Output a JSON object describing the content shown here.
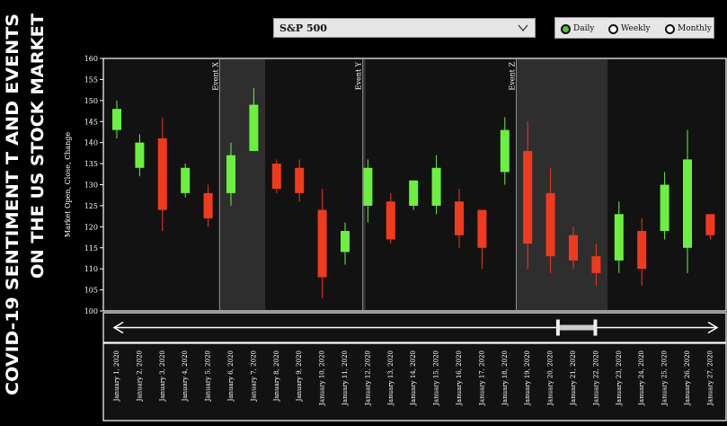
{
  "page_title": "COVID-19 SENTIMENT T AND EVENTS ON THE US STOCK MARKET",
  "page_title_lines": [
    "COVID-19 SENTIMENT T AND EVENTS",
    "ON THE US STOCK MARKET"
  ],
  "index_select": {
    "value": "S&P 500"
  },
  "period_options": [
    {
      "label": "Daily",
      "selected": true
    },
    {
      "label": "Weekly",
      "selected": false
    },
    {
      "label": "Monthly",
      "selected": false
    }
  ],
  "colors": {
    "up": "#6cf040",
    "down": "#f03a1e",
    "event_shade": "#2e2e2e",
    "panel": "#121212",
    "accent": "#5fbf3a"
  },
  "chart_data": {
    "type": "candlestick",
    "ylabel": "Market Open, Close, Change",
    "ylim": [
      100,
      160
    ],
    "yticks": [
      100,
      105,
      110,
      115,
      120,
      125,
      130,
      135,
      140,
      145,
      150,
      155,
      160
    ],
    "categories": [
      "January 1, 2020",
      "January 2, 2020",
      "January 3, 2020",
      "January 4, 2020",
      "January 5, 2020",
      "January 6, 2020",
      "January 7, 2020",
      "January 8, 2020",
      "January 9, 2020",
      "January 10, 2020",
      "January 11, 2020",
      "January 12, 2020",
      "January 13, 2020",
      "January 14, 2020",
      "January 15, 2020",
      "January 16, 2020",
      "January 17, 2020",
      "January 18, 2020",
      "January 19, 2020",
      "January 20, 2020",
      "January 21, 2020",
      "January 22, 2020",
      "January 23, 2020",
      "January 24, 2020",
      "January 25, 2020",
      "January 26, 2020",
      "January 27, 2020"
    ],
    "open": [
      143,
      134,
      141,
      128,
      128,
      128,
      138,
      135,
      134,
      124,
      114,
      125,
      126,
      125,
      125,
      126,
      124,
      133,
      138,
      128,
      118,
      113,
      112,
      119,
      119,
      115,
      123
    ],
    "close": [
      148,
      140,
      124,
      134,
      122,
      137,
      149,
      129,
      128,
      108,
      119,
      134,
      117,
      131,
      134,
      118,
      115,
      143,
      116,
      113,
      112,
      109,
      123,
      110,
      130,
      136,
      118
    ],
    "high": [
      150,
      142,
      146,
      135,
      130,
      140,
      153,
      136,
      136,
      129,
      121,
      136,
      128,
      131,
      137,
      129,
      124,
      146,
      145,
      134,
      120,
      116,
      126,
      122,
      133,
      143,
      123
    ],
    "low": [
      141,
      132,
      119,
      127,
      120,
      125,
      138,
      128,
      126,
      103,
      111,
      121,
      116,
      124,
      123,
      115,
      110,
      130,
      110,
      109,
      110,
      106,
      109,
      106,
      117,
      109,
      117
    ],
    "events": [
      {
        "label": "Event X",
        "shade_from": "January 6, 2020",
        "shade_to": "January 7, 2020"
      },
      {
        "label": "Event Y",
        "shade_from": "January 12, 2020",
        "shade_to": "January 12, 2020"
      },
      {
        "label": "Event Z",
        "shade_from": "January 19, 2020",
        "shade_to": "January 22, 2020"
      }
    ],
    "range_slider": {
      "window_start_fraction": 0.73,
      "window_end_fraction": 0.79
    }
  }
}
